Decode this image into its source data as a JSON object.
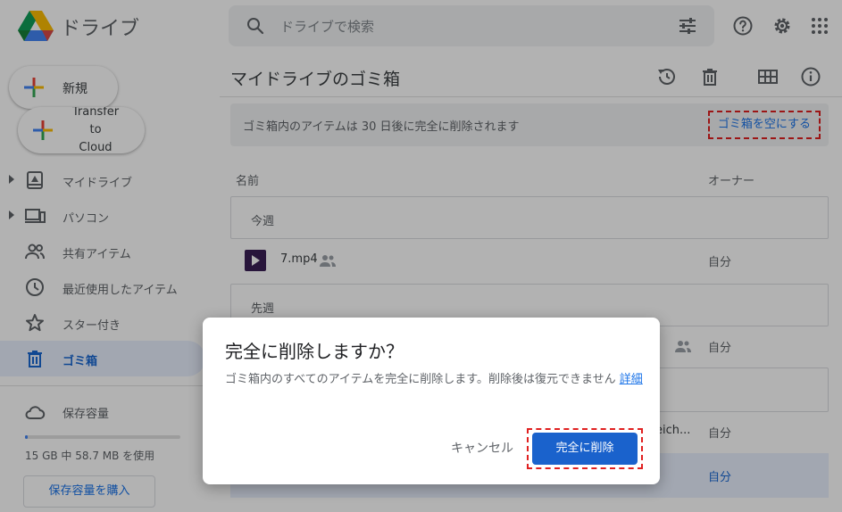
{
  "header": {
    "brand": "ドライブ",
    "search_placeholder": "ドライブで検索"
  },
  "sidebar": {
    "new_label": "新規",
    "transfer_label_lines": [
      "Transfer",
      "to",
      "Cloud"
    ],
    "items": [
      {
        "label": "マイドライブ",
        "icon": "my-drive-icon",
        "expandable": true
      },
      {
        "label": "パソコン",
        "icon": "computers-icon",
        "expandable": true
      },
      {
        "label": "共有アイテム",
        "icon": "shared-icon",
        "expandable": false
      },
      {
        "label": "最近使用したアイテム",
        "icon": "clock-icon",
        "expandable": false
      },
      {
        "label": "スター付き",
        "icon": "star-icon",
        "expandable": false
      },
      {
        "label": "ゴミ箱",
        "icon": "trash-icon",
        "expandable": false,
        "active": true
      }
    ],
    "storage_label": "保存容量",
    "usage_text": "15 GB 中 58.7 MB を使用",
    "usage_fraction": 0.004,
    "buy_storage_label": "保存容量を購入"
  },
  "main": {
    "title": "マイドライブのゴミ箱",
    "banner_text": "ゴミ箱内のアイテムは 30 日後に完全に削除されます",
    "empty_trash_label": "ゴミ箱を空にする",
    "col_name": "名前",
    "col_owner": "オーナー",
    "group_this_week": "今週",
    "group_last_week": "先週",
    "file1_name": "7.mp4",
    "file1_owner": "自分",
    "row2_owner": "自分",
    "row3_fragment": "eich...",
    "row3_owner": "自分",
    "row4_owner": "自分"
  },
  "dialog": {
    "title": "完全に削除しますか？",
    "body": "ゴミ箱内のすべてのアイテムを完全に削除します。削除後は復元できません",
    "details_link": "詳細",
    "cancel_label": "キャンセル",
    "delete_label": "完全に削除"
  },
  "colors": {
    "accent": "#1a73e8",
    "active_bg": "#e8f0fe",
    "highlight_dash": "#e02020",
    "delete_button": "#1a62cc"
  }
}
